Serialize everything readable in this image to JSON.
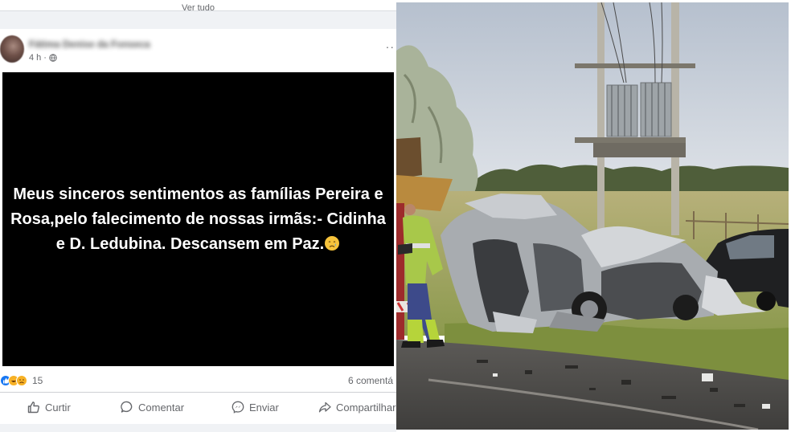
{
  "post": {
    "top_link": "Ver tudo",
    "time": "4 h",
    "separator": "·",
    "author": "Fátima Denise da Fonseca",
    "text": "Meus sinceros sentimentos as famílias Pereira e Rosa,pelo falecimento de nossas irmãs:- Cidinha e D. Ledubina. Descansem em Paz.",
    "background_color": "#000000",
    "text_color": "#ffffff"
  },
  "stats": {
    "reaction_count": "15",
    "comments": "6 comentá"
  },
  "actions": {
    "like": "Curtir",
    "comment": "Comentar",
    "send": "Enviar",
    "share": "Compartilhar"
  },
  "icons": {
    "globe": "globe-icon",
    "more": "more-icon",
    "emoji": "crying-face-icon",
    "like": "thumbs-up-icon",
    "comment": "speech-bubble-icon",
    "send": "messenger-icon",
    "share": "share-arrow-icon"
  },
  "colors": {
    "fb_blue": "#1877f2",
    "secondary_text": "#65676b",
    "divider": "#ced0d4"
  }
}
